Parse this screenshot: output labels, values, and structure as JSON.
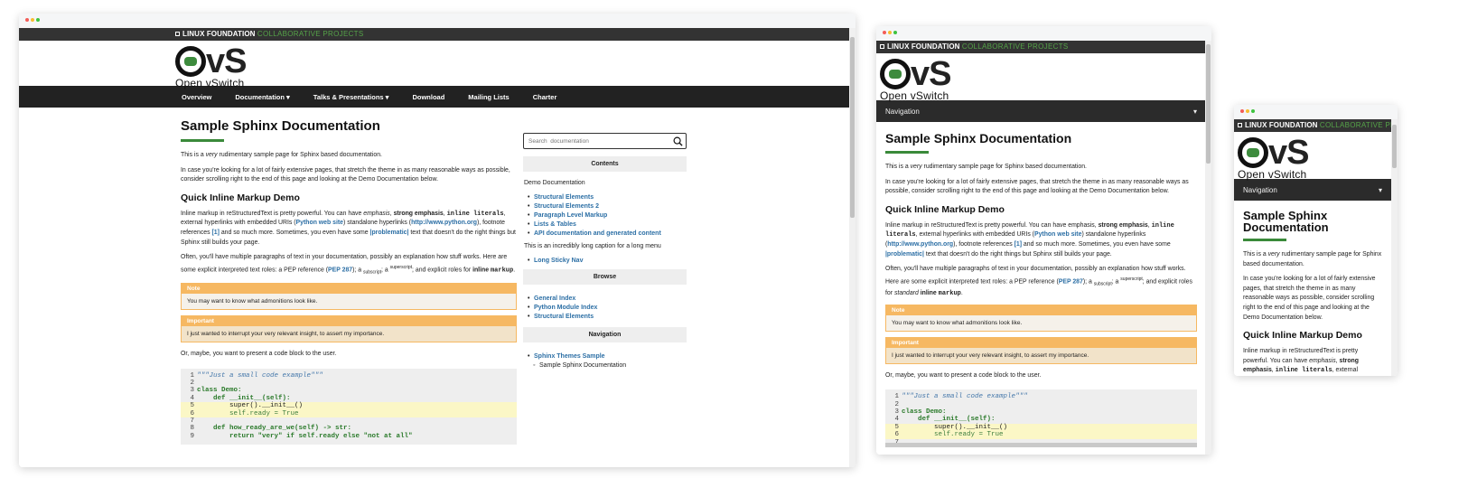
{
  "lf": {
    "brand": "LINUX FOUNDATION",
    "sub": "COLLABORATIVE PROJECTS"
  },
  "logo": {
    "sub": "Open vSwitch"
  },
  "nav": [
    "Overview",
    "Documentation ▾",
    "Talks & Presentations ▾",
    "Download",
    "Mailing Lists",
    "Charter"
  ],
  "nav_collapsed": {
    "label": "Navigation",
    "caret": "▾"
  },
  "doc": {
    "title": "Sample Sphinx Documentation",
    "p1_a": "This is a ",
    "p1_em": "very",
    "p1_b": " rudimentary sample page for Sphinx based documentation.",
    "p2": "In case you're looking for a lot of fairly extensive pages, that stretch the theme in as many reasonable ways as possible, consider scrolling right to the end of this page and looking at the Demo Documentation below.",
    "h2": "Quick Inline Markup Demo",
    "p3_a": "Inline markup in reStructuredText is pretty powerful. You can have ",
    "p3_em": "emphasis",
    "p3_b": ", ",
    "p3_strong": "strong emphasis",
    "p3_c": ", ",
    "p3_code": "inline literals",
    "p3_d": ", external hyperlinks with embedded URIs (",
    "p3_link1": "Python web site",
    "p3_e": ") standalone hyperlinks (",
    "p3_link2": "http://www.python.org",
    "p3_f": "), footnote references ",
    "p3_fn": "[1]",
    "p3_g": " and so much more. Sometimes, you even have some ",
    "p3_prob": "|problematic|",
    "p3_h": " text that doesn't do the right things but Sphinx still builds your page.",
    "p4_a": "Often, you'll have multiple paragraphs of text in your documentation, possibly an explanation how stuff works. Here are some explicit interpreted text roles: a PEP reference (",
    "p4_pep": "PEP 287",
    "p4_b": "); a ",
    "p4_sub": "subscript",
    "p4_c": "; a ",
    "p4_sup": "superscript",
    "p4_d": "; and explicit roles for ",
    "p4_std": "standard",
    "p4_e": " ",
    "p4_inline": "inline",
    "p4_f": " ",
    "p4_markup": "markup",
    "p4_g": ".",
    "note_title": "Note",
    "note_body": "You may want to know what admonitions look like.",
    "imp_title": "Important",
    "imp_body": "I just wanted to interrupt your very relevant insight, to assert my importance.",
    "p5": "Or, maybe, you want to present a code block to the user."
  },
  "code_lines": [
    {
      "n": "1",
      "t": "\"\"\"Just a small code example\"\"\""
    },
    {
      "n": "2",
      "t": ""
    },
    {
      "n": "3",
      "t": "class Demo:"
    },
    {
      "n": "4",
      "t": "    def __init__(self):"
    },
    {
      "n": "5",
      "t": "        super().__init__()"
    },
    {
      "n": "6",
      "t": "        self.ready = True"
    },
    {
      "n": "7",
      "t": ""
    },
    {
      "n": "8",
      "t": "    def how_ready_are_we(self) -> str:"
    },
    {
      "n": "9",
      "t": "        return \"very\" if self.ready else \"not at all\""
    }
  ],
  "sidebar": {
    "search_placeholder": "Search  documentation",
    "contents": "Contents",
    "demo": "Demo Documentation",
    "toc": [
      "Structural Elements",
      "Structural Elements 2",
      "Paragraph Level Markup",
      "Lists & Tables",
      "API documentation and generated content"
    ],
    "caption": "This is an incredibly long caption for a long menu",
    "sticky": "Long Sticky Nav",
    "browse": "Browse",
    "browse_items": [
      "General Index",
      "Python Module Index",
      "Structural Elements"
    ],
    "navigation": "Navigation",
    "nav_items": [
      "Sphinx Themes Sample",
      "Sample Sphinx Documentation"
    ]
  }
}
